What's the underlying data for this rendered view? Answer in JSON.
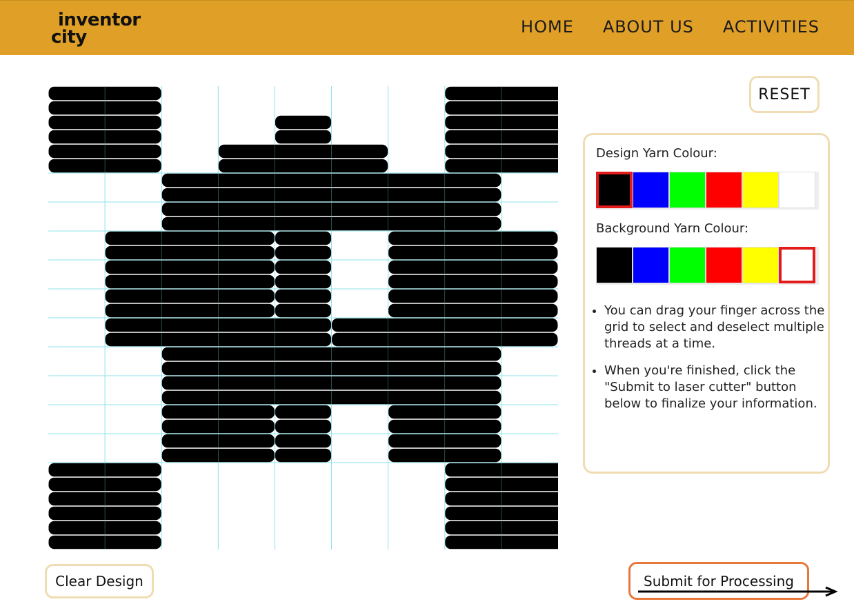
{
  "nav": {
    "logo_line1": "inventor",
    "logo_line2": "city",
    "links": [
      "HOME",
      "ABOUT US",
      "ACTIVITIES"
    ]
  },
  "controls": {
    "reset_label": "RESET",
    "clear_label": "Clear Design",
    "submit_label": "Submit for Processing"
  },
  "panel": {
    "design_label": "Design Yarn Colour:",
    "background_label": "Background Yarn Colour:",
    "colors": [
      "#000000",
      "#0000ff",
      "#00ff00",
      "#ff0000",
      "#ffff00",
      "#ffffff"
    ],
    "color_names": [
      "black",
      "blue",
      "green",
      "red",
      "yellow",
      "white"
    ],
    "design_selected": "black",
    "background_selected": "white",
    "tips": [
      "You can drag your finger across the grid to select and deselect multiple threads at a time.",
      "When you're finished, click the \"Submit to laser cutter\" button below to finalize your information."
    ]
  },
  "weave": {
    "columns": 9,
    "rows": 32,
    "thread_color": "#000000",
    "grid_line_color": "#8fe3e8",
    "threads": [
      [
        0,
        0,
        0,
        1
      ],
      [
        0,
        7,
        8,
        1
      ],
      [
        1,
        0,
        0,
        1
      ],
      [
        1,
        7,
        8,
        1
      ],
      [
        2,
        0,
        0,
        1
      ],
      [
        2,
        4,
        4,
        0
      ],
      [
        2,
        7,
        8,
        1
      ],
      [
        3,
        0,
        0,
        1
      ],
      [
        3,
        4,
        4,
        0
      ],
      [
        3,
        7,
        8,
        1
      ],
      [
        4,
        0,
        0,
        1
      ],
      [
        4,
        3,
        5,
        0
      ],
      [
        4,
        7,
        8,
        1
      ],
      [
        5,
        0,
        0,
        1
      ],
      [
        5,
        3,
        5,
        0
      ],
      [
        5,
        7,
        8,
        1
      ],
      [
        6,
        2,
        7,
        0
      ],
      [
        7,
        2,
        7,
        0
      ],
      [
        8,
        2,
        7,
        0
      ],
      [
        9,
        2,
        7,
        0
      ],
      [
        10,
        1,
        3,
        0
      ],
      [
        10,
        4,
        4,
        0
      ],
      [
        10,
        6,
        8,
        0
      ],
      [
        11,
        1,
        3,
        0
      ],
      [
        11,
        4,
        4,
        0
      ],
      [
        11,
        6,
        8,
        0
      ],
      [
        12,
        1,
        3,
        0
      ],
      [
        12,
        4,
        4,
        0
      ],
      [
        12,
        6,
        8,
        0
      ],
      [
        13,
        1,
        3,
        0
      ],
      [
        13,
        4,
        4,
        0
      ],
      [
        13,
        6,
        8,
        0
      ],
      [
        14,
        1,
        3,
        0
      ],
      [
        14,
        4,
        4,
        0
      ],
      [
        14,
        6,
        8,
        0
      ],
      [
        15,
        1,
        3,
        0
      ],
      [
        15,
        4,
        4,
        0
      ],
      [
        15,
        6,
        8,
        0
      ],
      [
        16,
        1,
        4,
        0
      ],
      [
        16,
        5,
        8,
        0
      ],
      [
        17,
        1,
        4,
        0
      ],
      [
        17,
        5,
        8,
        0
      ],
      [
        18,
        2,
        7,
        0
      ],
      [
        19,
        2,
        7,
        0
      ],
      [
        20,
        2,
        7,
        0
      ],
      [
        21,
        2,
        7,
        0
      ],
      [
        22,
        2,
        3,
        0
      ],
      [
        22,
        4,
        4,
        0
      ],
      [
        22,
        6,
        7,
        0
      ],
      [
        23,
        2,
        3,
        0
      ],
      [
        23,
        4,
        4,
        0
      ],
      [
        23,
        6,
        7,
        0
      ],
      [
        24,
        2,
        3,
        0
      ],
      [
        24,
        4,
        4,
        0
      ],
      [
        24,
        6,
        7,
        0
      ],
      [
        25,
        2,
        3,
        0
      ],
      [
        25,
        4,
        4,
        0
      ],
      [
        25,
        6,
        7,
        0
      ],
      [
        26,
        0,
        0,
        1
      ],
      [
        26,
        7,
        8,
        1
      ],
      [
        27,
        0,
        0,
        1
      ],
      [
        27,
        7,
        8,
        1
      ],
      [
        28,
        0,
        0,
        1
      ],
      [
        28,
        7,
        8,
        1
      ],
      [
        29,
        0,
        0,
        1
      ],
      [
        29,
        7,
        8,
        1
      ],
      [
        30,
        0,
        0,
        1
      ],
      [
        30,
        7,
        8,
        1
      ],
      [
        31,
        0,
        0,
        1
      ],
      [
        31,
        7,
        8,
        1
      ]
    ]
  }
}
